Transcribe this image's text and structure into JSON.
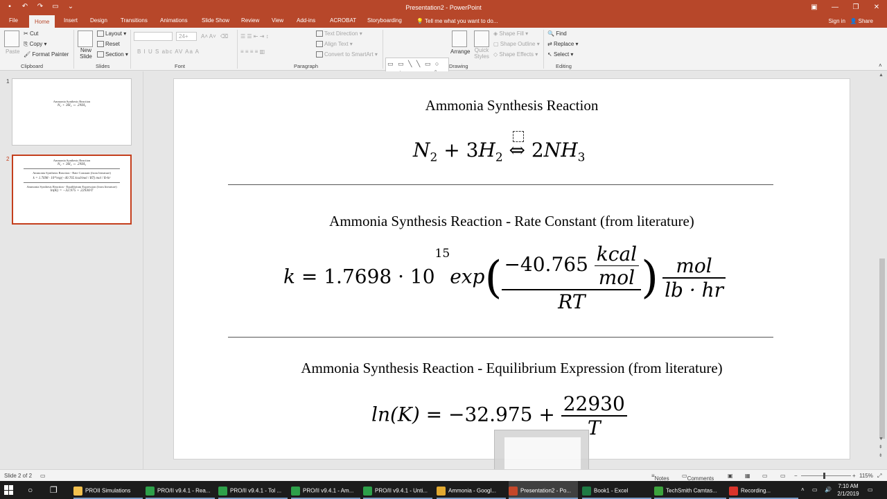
{
  "window": {
    "title": "Presentation2 - PowerPoint",
    "signin": "Sign in",
    "share": "Share",
    "tell_me": "Tell me what you want to do..."
  },
  "tabs": [
    "File",
    "Home",
    "Insert",
    "Design",
    "Transitions",
    "Animations",
    "Slide Show",
    "Review",
    "View",
    "Add-ins",
    "ACROBAT",
    "Storyboarding"
  ],
  "ribbon": {
    "clipboard": {
      "paste": "Paste",
      "cut": "Cut",
      "copy": "Copy",
      "format_painter": "Format Painter",
      "label": "Clipboard"
    },
    "slides": {
      "new_slide": "New Slide",
      "layout": "Layout",
      "reset": "Reset",
      "section": "Section",
      "label": "Slides"
    },
    "font": {
      "size": "24+",
      "label": "Font",
      "buttons": "B  I  U  S  abc  AV  Aa  A"
    },
    "paragraph": {
      "text_direction": "Text Direction",
      "align_text": "Align Text",
      "convert": "Convert to SmartArt",
      "label": "Paragraph"
    },
    "drawing": {
      "arrange": "Arrange",
      "quick_styles": "Quick Styles",
      "shape_fill": "Shape Fill",
      "shape_outline": "Shape Outline",
      "shape_effects": "Shape Effects",
      "label": "Drawing",
      "shapes": "▭ ▭ ╲ ╲ ▭ ○ ▭ △ ⌐ ⌐ ⇨ ⇩ ⇦ ⇧ ∿ ∩ ⌒ ⌒ { } ☆"
    },
    "editing": {
      "find": "Find",
      "replace": "Replace",
      "select": "Select",
      "label": "Editing"
    }
  },
  "thumbnails": [
    {
      "number": "1",
      "title": "Ammonia Synthesis Reaction",
      "formula": "N₂ + 3H₂ ⇔ 2NH₃"
    },
    {
      "number": "2",
      "title": "Ammonia Synthesis Reaction",
      "formula": "N₂ + 3H₂ ⇔ 2NH₃",
      "title2": "Ammonia Synthesis Reaction - Rate Constant (from literature)",
      "formula2": "k = 1.7698 · 10¹⁵exp(−40.765 kcal/mol / RT) mol / lb·hr",
      "title3": "Ammonia Synthesis Reaction - Equilibrium Expression (from literature)",
      "formula3": "ln(K) = −32.975 + 22930/T"
    }
  ],
  "slide": {
    "title1": "Ammonia Synthesis Reaction",
    "eq1": {
      "n": "N",
      "n_sub": "2",
      "plus": " + 3",
      "h": "H",
      "h_sub": "2",
      "arrow": " ⇔ 2",
      "nh": "NH",
      "nh_sub": "3"
    },
    "title2": "Ammonia Synthesis Reaction  - Rate Constant (from literature)",
    "eq2": {
      "k": "k",
      "eq": " = 1.7698 · 10",
      "exp15": "15",
      "exp": "exp",
      "coef": "−40.765",
      "kcal": "kcal",
      "mol": "mol",
      "rt": "RT",
      "mol2": "mol",
      "lbhr": "lb · hr",
      "lparen": "(",
      "rparen": ")"
    },
    "title3": "Ammonia Synthesis Reaction  - Equilibrium Expression (from literature)",
    "eq3": {
      "lhs": "ln(K)",
      "rhs": " = −32.975 + ",
      "num": "22930",
      "den": "T"
    }
  },
  "status": {
    "slide": "Slide 2 of 2",
    "notes": "Notes",
    "comments": "Comments",
    "zoom": "115%"
  },
  "taskbar": {
    "items": [
      {
        "label": "PROII Simulations",
        "color": "#f2c14e"
      },
      {
        "label": "PRO/II v9.4.1 - Rea...",
        "color": "#2ea04a"
      },
      {
        "label": "PRO/II v9.4.1 - Tol ...",
        "color": "#2ea04a"
      },
      {
        "label": "PRO/II v9.4.1 - Am...",
        "color": "#2ea04a"
      },
      {
        "label": "PRO/II v9.4.1 - Unti...",
        "color": "#2ea04a"
      },
      {
        "label": "Ammonia - Googl...",
        "color": "#e2a930"
      },
      {
        "label": "Presentation2 - Po...",
        "color": "#c4472a"
      },
      {
        "label": "Book1 - Excel",
        "color": "#1f7a44"
      },
      {
        "label": "TechSmith Camtas...",
        "color": "#3da33d"
      },
      {
        "label": "Recording...",
        "color": "#d9342b"
      }
    ],
    "time": "7:10 AM",
    "date": "2/1/2019"
  }
}
